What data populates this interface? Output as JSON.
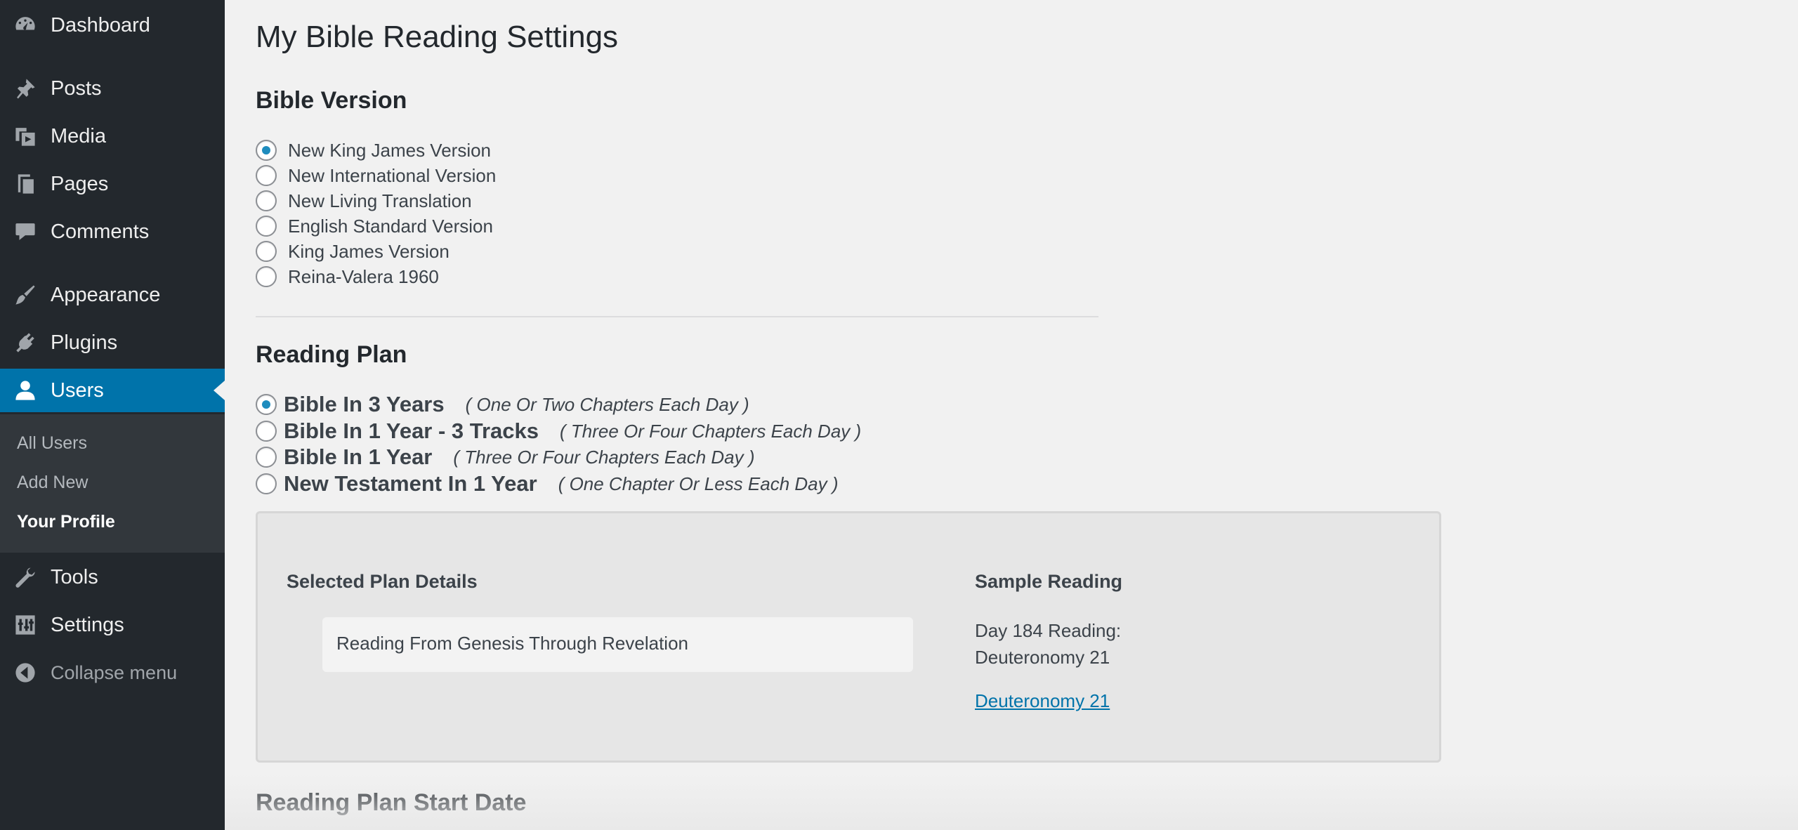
{
  "sidebar": {
    "items": [
      {
        "label": "Dashboard",
        "icon": "dashboard-icon"
      },
      {
        "label": "Posts",
        "icon": "pushpin-icon"
      },
      {
        "label": "Media",
        "icon": "media-icon"
      },
      {
        "label": "Pages",
        "icon": "pages-icon"
      },
      {
        "label": "Comments",
        "icon": "comment-icon"
      },
      {
        "label": "Appearance",
        "icon": "paintbrush-icon"
      },
      {
        "label": "Plugins",
        "icon": "plug-icon"
      },
      {
        "label": "Users",
        "icon": "user-icon"
      },
      {
        "label": "Tools",
        "icon": "wrench-icon"
      },
      {
        "label": "Settings",
        "icon": "sliders-icon"
      },
      {
        "label": "Collapse menu",
        "icon": "collapse-arrow-icon"
      }
    ],
    "submenu": [
      "All Users",
      "Add New",
      "Your Profile"
    ],
    "active_item": "Users",
    "active_subitem": "Your Profile"
  },
  "main": {
    "page_title": "My Bible Reading Settings",
    "bible_version": {
      "heading": "Bible Version",
      "options": [
        {
          "label": "New King James Version",
          "checked": true
        },
        {
          "label": "New International Version",
          "checked": false
        },
        {
          "label": "New Living Translation",
          "checked": false
        },
        {
          "label": "English Standard Version",
          "checked": false
        },
        {
          "label": "King James Version",
          "checked": false
        },
        {
          "label": "Reina-Valera 1960",
          "checked": false
        }
      ]
    },
    "reading_plan": {
      "heading": "Reading Plan",
      "options": [
        {
          "label": "Bible In 3 Years",
          "description": "( One Or Two Chapters Each Day )",
          "checked": true
        },
        {
          "label": "Bible In 1 Year - 3 Tracks",
          "description": "( Three Or Four Chapters Each Day )",
          "checked": false
        },
        {
          "label": "Bible In 1 Year",
          "description": "( Three Or Four Chapters Each Day )",
          "checked": false
        },
        {
          "label": "New Testament In 1 Year",
          "description": "( One Chapter Or Less Each Day )",
          "checked": false
        }
      ]
    },
    "details": {
      "selected_heading": "Selected Plan Details",
      "selected_text": "Reading From Genesis Through Revelation",
      "sample_heading": "Sample Reading",
      "sample_line1": "Day 184 Reading:",
      "sample_line2": "Deuteronomy 21",
      "sample_link": "Deuteronomy 21"
    },
    "start_date_heading": "Reading Plan Start Date"
  },
  "colors": {
    "sidebar_bg": "#23282d",
    "submenu_bg": "#32373c",
    "accent": "#0073aa",
    "radio_checked": "#1e8cbe",
    "page_bg": "#f1f1f1"
  }
}
